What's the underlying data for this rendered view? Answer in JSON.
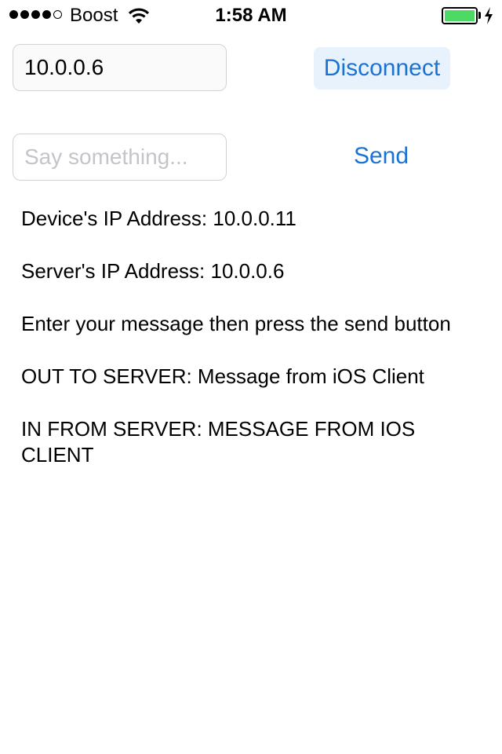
{
  "status_bar": {
    "signal": {
      "filled": 4,
      "total": 5
    },
    "carrier": "Boost",
    "time": "1:58 AM",
    "battery_level": 1.0,
    "battery_color": "#4cd964",
    "charging": true,
    "icons": [
      "wifi-icon",
      "battery-icon",
      "charging-bolt-icon"
    ]
  },
  "connection": {
    "ip_value": "10.0.0.6",
    "disconnect_label": "Disconnect"
  },
  "message": {
    "placeholder": "Say something...",
    "value": "",
    "send_label": "Send"
  },
  "log": {
    "device_ip": "Device's IP Address: 10.0.0.11",
    "server_ip": "Server's IP Address: 10.0.0.6",
    "instructions": "Enter your message then press the send button",
    "out_to_server": "OUT TO SERVER: Message from iOS Client",
    "in_from_server": "IN FROM SERVER: MESSAGE FROM IOS CLIENT"
  },
  "colors": {
    "accent": "#1a73d4",
    "button_background": "#e8f2fd",
    "field_border": "#d2d2d2",
    "placeholder": "#c4c4c9"
  }
}
